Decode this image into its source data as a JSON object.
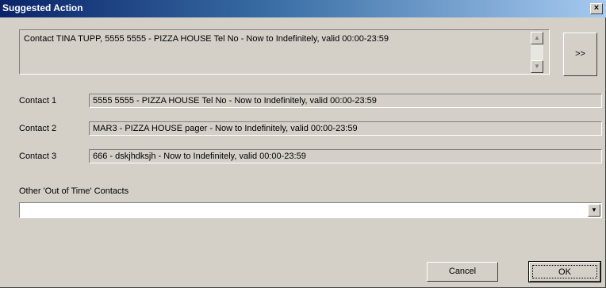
{
  "window": {
    "title": "Suggested Action",
    "close_label": "×"
  },
  "suggestion": {
    "text": "Contact TINA TUPP,  5555 5555 - PIZZA HOUSE Tel No - Now to Indefinitely, valid 00:00-23:59",
    "next_label": ">>"
  },
  "contacts": [
    {
      "label": "Contact 1",
      "value": "5555 5555 - PIZZA HOUSE Tel No - Now to Indefinitely, valid 00:00-23:59"
    },
    {
      "label": "Contact 2",
      "value": "MAR3 - PIZZA HOUSE pager - Now to Indefinitely, valid 00:00-23:59"
    },
    {
      "label": "Contact 3",
      "value": "666 - dskjhdksjh - Now to Indefinitely, valid 00:00-23:59"
    }
  ],
  "other": {
    "label": "Other 'Out of Time' Contacts",
    "selected": ""
  },
  "buttons": {
    "cancel": "Cancel",
    "ok": "OK"
  },
  "icons": {
    "scroll_up": "scroll-up-arrow-icon",
    "scroll_down": "scroll-down-arrow-icon",
    "dropdown": "dropdown-arrow-icon"
  }
}
